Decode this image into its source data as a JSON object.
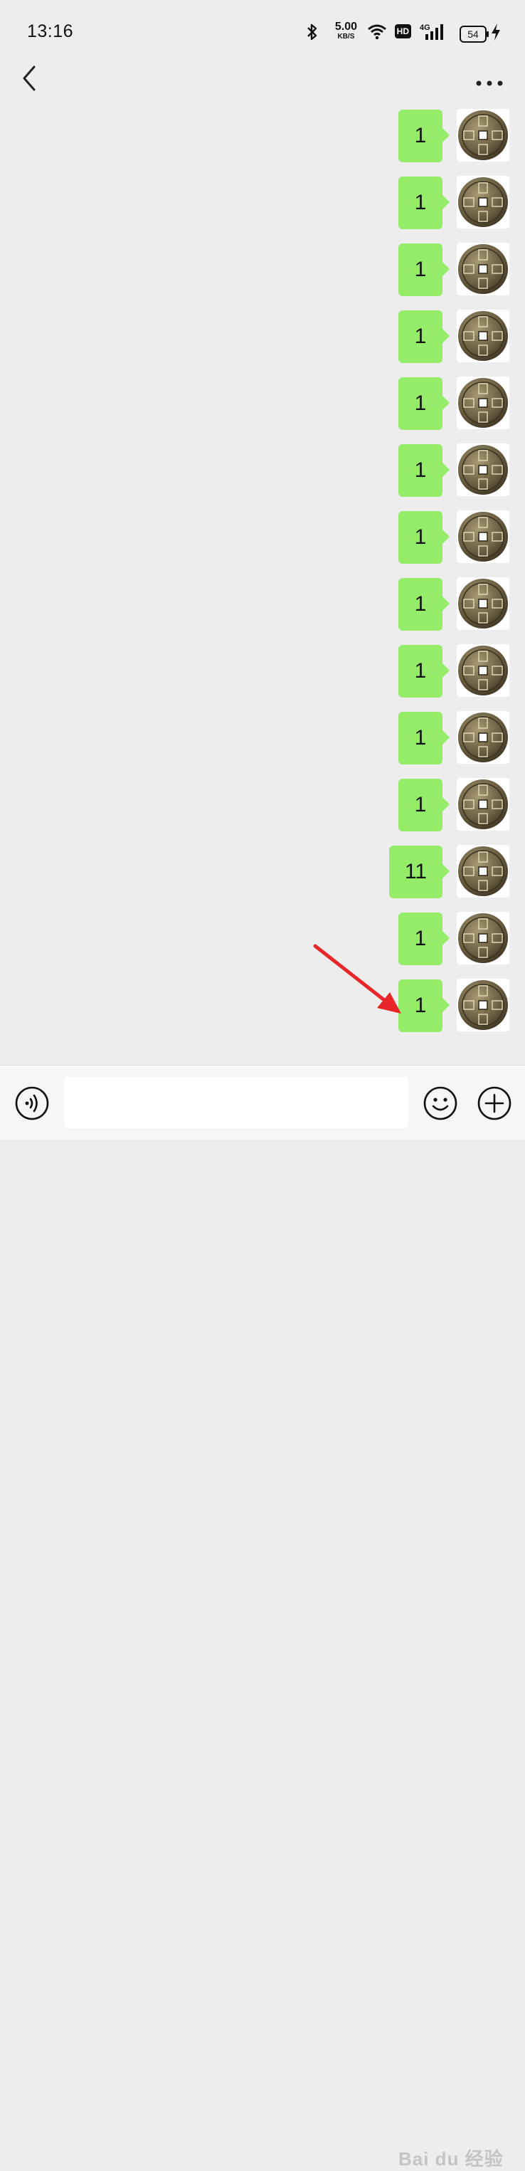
{
  "status_bar": {
    "time": "13:16",
    "net_speed_value": "5.00",
    "net_speed_unit": "KB/S",
    "hd_label": "HD",
    "network_type": "4G",
    "battery_level": "54",
    "icons": [
      "bluetooth-icon",
      "wifi-icon",
      "signal-icon",
      "charging-icon"
    ]
  },
  "nav": {
    "back_icon": "chevron-left-icon",
    "more_icon": "more-dots-icon"
  },
  "messages": [
    {
      "text": "1",
      "sender": "self"
    },
    {
      "text": "1",
      "sender": "self"
    },
    {
      "text": "1",
      "sender": "self"
    },
    {
      "text": "1",
      "sender": "self"
    },
    {
      "text": "1",
      "sender": "self"
    },
    {
      "text": "1",
      "sender": "self"
    },
    {
      "text": "1",
      "sender": "self"
    },
    {
      "text": "1",
      "sender": "self"
    },
    {
      "text": "1",
      "sender": "self"
    },
    {
      "text": "1",
      "sender": "self"
    },
    {
      "text": "1",
      "sender": "self"
    },
    {
      "text": "11",
      "sender": "self"
    },
    {
      "text": "1",
      "sender": "self"
    },
    {
      "text": "1",
      "sender": "self"
    }
  ],
  "colors": {
    "background": "#ededed",
    "bubble_self": "#95ec69",
    "annotation_arrow": "#e8262a"
  },
  "input_bar": {
    "text_value": "",
    "voice_icon": "voice-icon",
    "emoji_icon": "emoji-icon",
    "plus_icon": "plus-icon"
  },
  "watermark": "Bai du 经验"
}
